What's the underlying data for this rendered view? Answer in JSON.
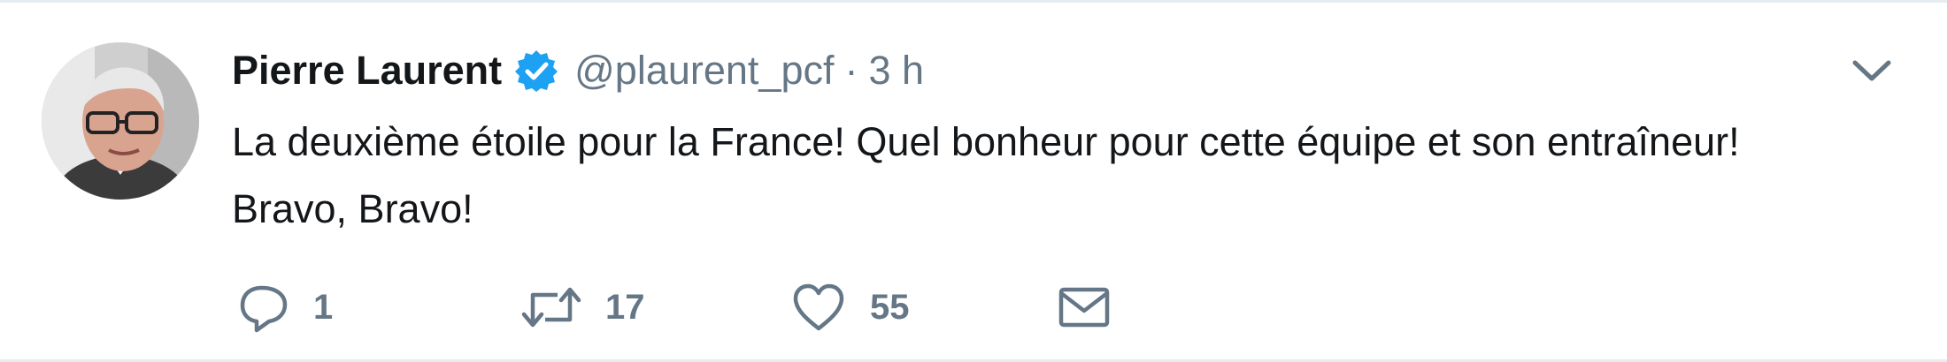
{
  "tweet": {
    "author": {
      "name": "Pierre Laurent",
      "handle": "@plaurent_pcf",
      "verified": true
    },
    "separator": "·",
    "timestamp": "3 h",
    "text": "La deuxième étoile pour la France! Quel bonheur pour cette équipe et son entraîneur! Bravo, Bravo!",
    "actions": {
      "reply": {
        "icon": "reply-icon",
        "count": "1"
      },
      "retweet": {
        "icon": "retweet-icon",
        "count": "17"
      },
      "like": {
        "icon": "heart-icon",
        "count": "55"
      },
      "message": {
        "icon": "envelope-icon"
      }
    },
    "menu_icon": "chevron-down-icon"
  },
  "colors": {
    "verified_blue": "#1da1f2",
    "text_primary": "#14171a",
    "text_secondary": "#657786",
    "border": "#e6ecf0"
  }
}
